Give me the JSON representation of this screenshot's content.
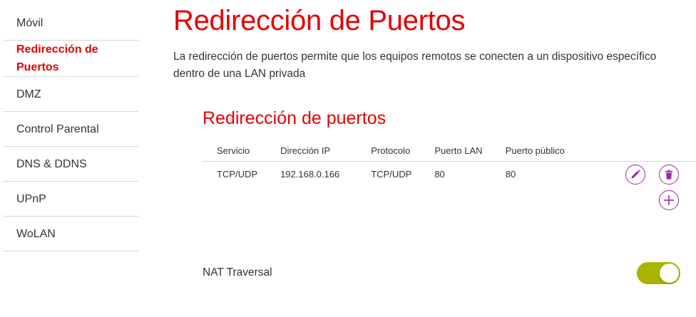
{
  "sidebar": {
    "items": [
      {
        "label": "Móvil",
        "active": false
      },
      {
        "label": "Redirección de Puertos",
        "active": true
      },
      {
        "label": "DMZ",
        "active": false
      },
      {
        "label": "Control Parental",
        "active": false
      },
      {
        "label": "DNS & DDNS",
        "active": false
      },
      {
        "label": "UPnP",
        "active": false
      },
      {
        "label": "WoLAN",
        "active": false
      }
    ]
  },
  "main": {
    "title": "Redirección de Puertos",
    "description": "La redirección de puertos permite que los equipos remotos se conecten a un dispositivo específico dentro de una LAN privada",
    "section_title": "Redirección de puertos",
    "table": {
      "headers": [
        "Servicio",
        "Dirección IP",
        "Protocolo",
        "Puerto LAN",
        "Puerto público"
      ],
      "rows": [
        [
          "TCP/UDP",
          "192.168.0.166",
          "TCP/UDP",
          "80",
          "80"
        ]
      ]
    },
    "nat_traversal": {
      "label": "NAT Traversal",
      "enabled": true
    }
  },
  "colors": {
    "accent": "#e60000",
    "action": "#9c2aa0",
    "toggle_on": "#a8b400"
  }
}
